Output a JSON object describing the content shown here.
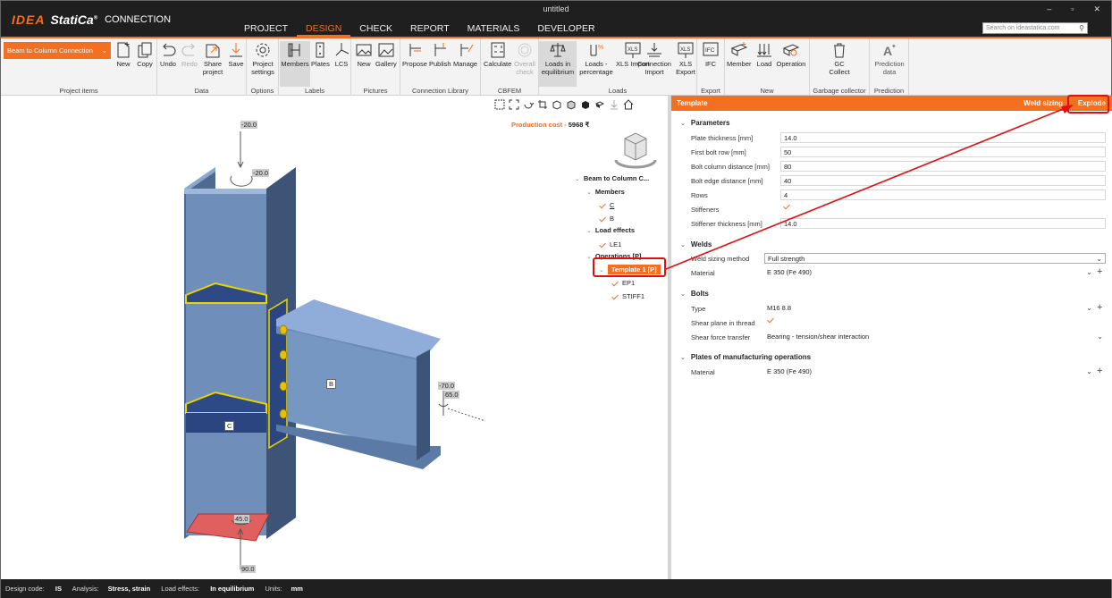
{
  "window": {
    "title": "untitled",
    "logo_idea": "IDEA",
    "logo_statica": "StatiCa",
    "logo_reg": "®",
    "logo_product": "CONNECTION",
    "search_placeholder": "Search on ideastatica.com",
    "controls": [
      "–",
      "▫",
      "✕"
    ]
  },
  "main_tabs": [
    "PROJECT",
    "DESIGN",
    "CHECK",
    "REPORT",
    "MATERIALS",
    "DEVELOPER"
  ],
  "active_tab": "DESIGN",
  "ribbon": {
    "project_item": "Beam to Column Connection",
    "groups": {
      "project_items": "Project items",
      "data": "Data",
      "options": "Options",
      "labels": "Labels",
      "pictures": "Pictures",
      "connection_library": "Connection Library",
      "cbfem": "CBFEM",
      "loads": "Loads",
      "export": "Export",
      "new": "New",
      "garbage": "Garbage collector",
      "prediction": "Prediction"
    },
    "buttons": {
      "new": "New",
      "copy": "Copy",
      "undo": "Undo",
      "redo": "Redo",
      "share": "Share project",
      "save": "Save",
      "project_settings": "Project settings",
      "members": "Members",
      "plates": "Plates",
      "lcs": "LCS",
      "pic_new": "New",
      "gallery": "Gallery",
      "propose": "Propose",
      "publish": "Publish",
      "manage": "Manage",
      "calculate": "Calculate",
      "overall_check": "Overall check",
      "loads_equilibrium": "Loads in equilibrium",
      "loads_percentage": "Loads - percentage",
      "xls_import": "XLS Import",
      "connection_import": "Connection Import",
      "xls_export": "XLS Export",
      "ifc": "IFC",
      "member": "Member",
      "load": "Load",
      "operation": "Operation",
      "gc_collect": "GC Collect",
      "prediction_data": "Prediction data"
    }
  },
  "viewport": {
    "production_cost_label": "Production cost",
    "production_cost_value": "5968 ₹",
    "load_labels": [
      "-20.0",
      "-20.0",
      "-70.0",
      "65.0",
      "45.0",
      "90.0"
    ],
    "member_labels": [
      "B",
      "C"
    ],
    "tree": {
      "root": "Beam to Column C...",
      "members": "Members",
      "member_c": "C",
      "member_b": "B",
      "load_effects": "Load effects",
      "le1": "LE1",
      "operations": "Operations [P]",
      "template": "Template 1 [P]",
      "ep1": "EP1",
      "stiff1": "STIFF1"
    }
  },
  "panel": {
    "title": "Template",
    "weld_sizing": "Weld sizing",
    "explode": "Explode",
    "parameters": {
      "header": "Parameters",
      "rows": [
        {
          "label": "Plate thickness [mm]",
          "value": "14.0"
        },
        {
          "label": "First bolt row [mm]",
          "value": "50"
        },
        {
          "label": "Bolt column distance [mm]",
          "value": "80"
        },
        {
          "label": "Bolt edge distance [mm]",
          "value": "40"
        },
        {
          "label": "Rows",
          "value": "4"
        },
        {
          "label": "Stiffeners",
          "value": ""
        },
        {
          "label": "Stiffener thickness [mm]",
          "value": "14.0"
        }
      ]
    },
    "welds": {
      "header": "Welds",
      "sizing_label": "Weld sizing method",
      "sizing_value": "Full strength",
      "material_label": "Material",
      "material_value": "E 350 (Fe 490)"
    },
    "bolts": {
      "header": "Bolts",
      "type_label": "Type",
      "type_value": "M16 8.8",
      "shear_plane_label": "Shear plane in thread",
      "shear_force_label": "Shear force transfer",
      "shear_force_value": "Bearing - tension/shear interaction"
    },
    "plates": {
      "header": "Plates of manufacturing operations",
      "material_label": "Material",
      "material_value": "E 350 (Fe 490)"
    }
  },
  "status": {
    "design_code_label": "Design code:",
    "design_code": "IS",
    "analysis_label": "Analysis:",
    "analysis": "Stress, strain",
    "load_effects_label": "Load effects:",
    "load_effects": "In equilibrium",
    "units_label": "Units:",
    "units": "mm"
  },
  "colors": {
    "accent": "#f36f21",
    "steel": "#7a9cc8",
    "highlight_red": "#e01010"
  }
}
